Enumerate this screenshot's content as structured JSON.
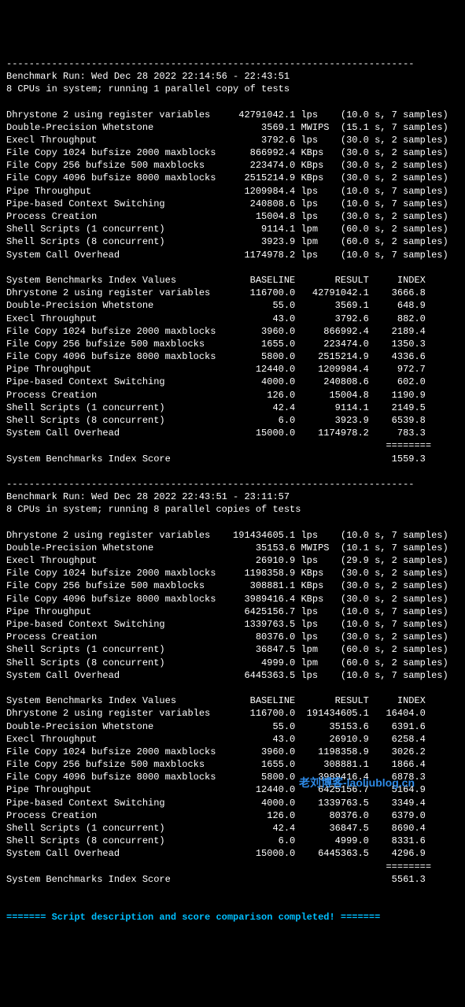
{
  "run1": {
    "divider": "------------------------------------------------------------------------",
    "header1": "Benchmark Run: Wed Dec 28 2022 22:14:56 - 22:43:51",
    "header2": "8 CPUs in system; running 1 parallel copy of tests",
    "tests": [
      {
        "name": "Dhrystone 2 using register variables",
        "value": "42791042.1",
        "unit": "lps",
        "timing": "(10.0 s, 7 samples)"
      },
      {
        "name": "Double-Precision Whetstone",
        "value": "3569.1",
        "unit": "MWIPS",
        "timing": "(15.1 s, 7 samples)"
      },
      {
        "name": "Execl Throughput",
        "value": "3792.6",
        "unit": "lps",
        "timing": "(30.0 s, 2 samples)"
      },
      {
        "name": "File Copy 1024 bufsize 2000 maxblocks",
        "value": "866992.4",
        "unit": "KBps",
        "timing": "(30.0 s, 2 samples)"
      },
      {
        "name": "File Copy 256 bufsize 500 maxblocks",
        "value": "223474.0",
        "unit": "KBps",
        "timing": "(30.0 s, 2 samples)"
      },
      {
        "name": "File Copy 4096 bufsize 8000 maxblocks",
        "value": "2515214.9",
        "unit": "KBps",
        "timing": "(30.0 s, 2 samples)"
      },
      {
        "name": "Pipe Throughput",
        "value": "1209984.4",
        "unit": "lps",
        "timing": "(10.0 s, 7 samples)"
      },
      {
        "name": "Pipe-based Context Switching",
        "value": "240808.6",
        "unit": "lps",
        "timing": "(10.0 s, 7 samples)"
      },
      {
        "name": "Process Creation",
        "value": "15004.8",
        "unit": "lps",
        "timing": "(30.0 s, 2 samples)"
      },
      {
        "name": "Shell Scripts (1 concurrent)",
        "value": "9114.1",
        "unit": "lpm",
        "timing": "(60.0 s, 2 samples)"
      },
      {
        "name": "Shell Scripts (8 concurrent)",
        "value": "3923.9",
        "unit": "lpm",
        "timing": "(60.0 s, 2 samples)"
      },
      {
        "name": "System Call Overhead",
        "value": "1174978.2",
        "unit": "lps",
        "timing": "(10.0 s, 7 samples)"
      }
    ],
    "index_header": {
      "title": "System Benchmarks Index Values",
      "baseline": "BASELINE",
      "result": "RESULT",
      "index": "INDEX"
    },
    "index": [
      {
        "name": "Dhrystone 2 using register variables",
        "baseline": "116700.0",
        "result": "42791042.1",
        "index": "3666.8"
      },
      {
        "name": "Double-Precision Whetstone",
        "baseline": "55.0",
        "result": "3569.1",
        "index": "648.9"
      },
      {
        "name": "Execl Throughput",
        "baseline": "43.0",
        "result": "3792.6",
        "index": "882.0"
      },
      {
        "name": "File Copy 1024 bufsize 2000 maxblocks",
        "baseline": "3960.0",
        "result": "866992.4",
        "index": "2189.4"
      },
      {
        "name": "File Copy 256 bufsize 500 maxblocks",
        "baseline": "1655.0",
        "result": "223474.0",
        "index": "1350.3"
      },
      {
        "name": "File Copy 4096 bufsize 8000 maxblocks",
        "baseline": "5800.0",
        "result": "2515214.9",
        "index": "4336.6"
      },
      {
        "name": "Pipe Throughput",
        "baseline": "12440.0",
        "result": "1209984.4",
        "index": "972.7"
      },
      {
        "name": "Pipe-based Context Switching",
        "baseline": "4000.0",
        "result": "240808.6",
        "index": "602.0"
      },
      {
        "name": "Process Creation",
        "baseline": "126.0",
        "result": "15004.8",
        "index": "1190.9"
      },
      {
        "name": "Shell Scripts (1 concurrent)",
        "baseline": "42.4",
        "result": "9114.1",
        "index": "2149.5"
      },
      {
        "name": "Shell Scripts (8 concurrent)",
        "baseline": "6.0",
        "result": "3923.9",
        "index": "6539.8"
      },
      {
        "name": "System Call Overhead",
        "baseline": "15000.0",
        "result": "1174978.2",
        "index": "783.3"
      }
    ],
    "score_divider": "                                                                   ========",
    "score_label": "System Benchmarks Index Score",
    "score_value": "1559.3"
  },
  "run2": {
    "divider": "------------------------------------------------------------------------",
    "header1": "Benchmark Run: Wed Dec 28 2022 22:43:51 - 23:11:57",
    "header2": "8 CPUs in system; running 8 parallel copies of tests",
    "tests": [
      {
        "name": "Dhrystone 2 using register variables",
        "value": "191434605.1",
        "unit": "lps",
        "timing": "(10.0 s, 7 samples)"
      },
      {
        "name": "Double-Precision Whetstone",
        "value": "35153.6",
        "unit": "MWIPS",
        "timing": "(10.1 s, 7 samples)"
      },
      {
        "name": "Execl Throughput",
        "value": "26910.9",
        "unit": "lps",
        "timing": "(29.9 s, 2 samples)"
      },
      {
        "name": "File Copy 1024 bufsize 2000 maxblocks",
        "value": "1198358.9",
        "unit": "KBps",
        "timing": "(30.0 s, 2 samples)"
      },
      {
        "name": "File Copy 256 bufsize 500 maxblocks",
        "value": "308881.1",
        "unit": "KBps",
        "timing": "(30.0 s, 2 samples)"
      },
      {
        "name": "File Copy 4096 bufsize 8000 maxblocks",
        "value": "3989416.4",
        "unit": "KBps",
        "timing": "(30.0 s, 2 samples)"
      },
      {
        "name": "Pipe Throughput",
        "value": "6425156.7",
        "unit": "lps",
        "timing": "(10.0 s, 7 samples)"
      },
      {
        "name": "Pipe-based Context Switching",
        "value": "1339763.5",
        "unit": "lps",
        "timing": "(10.0 s, 7 samples)"
      },
      {
        "name": "Process Creation",
        "value": "80376.0",
        "unit": "lps",
        "timing": "(30.0 s, 2 samples)"
      },
      {
        "name": "Shell Scripts (1 concurrent)",
        "value": "36847.5",
        "unit": "lpm",
        "timing": "(60.0 s, 2 samples)"
      },
      {
        "name": "Shell Scripts (8 concurrent)",
        "value": "4999.0",
        "unit": "lpm",
        "timing": "(60.0 s, 2 samples)"
      },
      {
        "name": "System Call Overhead",
        "value": "6445363.5",
        "unit": "lps",
        "timing": "(10.0 s, 7 samples)"
      }
    ],
    "index_header": {
      "title": "System Benchmarks Index Values",
      "baseline": "BASELINE",
      "result": "RESULT",
      "index": "INDEX"
    },
    "index": [
      {
        "name": "Dhrystone 2 using register variables",
        "baseline": "116700.0",
        "result": "191434605.1",
        "index": "16404.0"
      },
      {
        "name": "Double-Precision Whetstone",
        "baseline": "55.0",
        "result": "35153.6",
        "index": "6391.6"
      },
      {
        "name": "Execl Throughput",
        "baseline": "43.0",
        "result": "26910.9",
        "index": "6258.4"
      },
      {
        "name": "File Copy 1024 bufsize 2000 maxblocks",
        "baseline": "3960.0",
        "result": "1198358.9",
        "index": "3026.2"
      },
      {
        "name": "File Copy 256 bufsize 500 maxblocks",
        "baseline": "1655.0",
        "result": "308881.1",
        "index": "1866.4"
      },
      {
        "name": "File Copy 4096 bufsize 8000 maxblocks",
        "baseline": "5800.0",
        "result": "3989416.4",
        "index": "6878.3"
      },
      {
        "name": "Pipe Throughput",
        "baseline": "12440.0",
        "result": "6425156.7",
        "index": "5164.9"
      },
      {
        "name": "Pipe-based Context Switching",
        "baseline": "4000.0",
        "result": "1339763.5",
        "index": "3349.4"
      },
      {
        "name": "Process Creation",
        "baseline": "126.0",
        "result": "80376.0",
        "index": "6379.0"
      },
      {
        "name": "Shell Scripts (1 concurrent)",
        "baseline": "42.4",
        "result": "36847.5",
        "index": "8690.4"
      },
      {
        "name": "Shell Scripts (8 concurrent)",
        "baseline": "6.0",
        "result": "4999.0",
        "index": "8331.6"
      },
      {
        "name": "System Call Overhead",
        "baseline": "15000.0",
        "result": "6445363.5",
        "index": "4296.9"
      }
    ],
    "score_divider": "                                                                   ========",
    "score_label": "System Benchmarks Index Score",
    "score_value": "5561.3"
  },
  "footer": "======= Script description and score comparison completed! ======= ",
  "watermark": "老刘博客-laoliublog.cn"
}
